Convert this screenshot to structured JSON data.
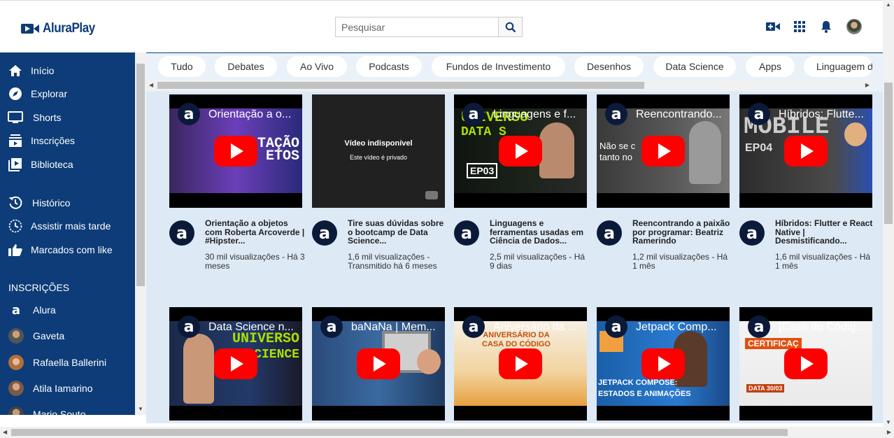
{
  "header": {
    "logo_text": "AluraPlay",
    "search_placeholder": "Pesquisar"
  },
  "sidebar": {
    "nav": [
      {
        "label": "Início",
        "icon": "home-icon"
      },
      {
        "label": "Explorar",
        "icon": "compass-icon"
      },
      {
        "label": "Shorts",
        "icon": "shorts-icon"
      },
      {
        "label": "Inscrições",
        "icon": "subscriptions-icon"
      },
      {
        "label": "Biblioteca",
        "icon": "library-icon"
      }
    ],
    "nav2": [
      {
        "label": "Histórico",
        "icon": "history-icon"
      },
      {
        "label": "Assistir mais tarde",
        "icon": "clock-icon"
      },
      {
        "label": "Marcados com like",
        "icon": "thumbs-up-icon"
      }
    ],
    "subscriptions_heading": "INSCRIÇÕES",
    "subscriptions": [
      {
        "label": "Alura"
      },
      {
        "label": "Gaveta"
      },
      {
        "label": "Rafaella Ballerini"
      },
      {
        "label": "Atila Iamarino"
      },
      {
        "label": "Mario Souto"
      }
    ]
  },
  "chips": [
    "Tudo",
    "Debates",
    "Ao Vivo",
    "Podcasts",
    "Fundos de Investimento",
    "Desenhos",
    "Data Science",
    "Apps",
    "Linguagem de"
  ],
  "videos": [
    {
      "thumb_title": "Orientação a o...",
      "title": "Orientação a objetos com Roberta Arcoverde | #Hipster...",
      "views": "30 mil visualizações - Há 3 meses"
    },
    {
      "unavailable": "Vídeo indisponível",
      "unavailable_sub": "Este vídeo é privado",
      "title": "Tire suas dúvidas sobre o bootcamp de Data Science...",
      "views": "1,6 mil visualizações - Transmitido há 6 meses"
    },
    {
      "thumb_title": "Linguagens e f...",
      "title": "Linguagens e ferramentas usadas em Ciência de Dados...",
      "views": "2,5 mil visualizações - Há 9 dias"
    },
    {
      "thumb_title": "Reencontrando...",
      "title": "Reencontrando a paixão por programar: Beatriz Ramerindo",
      "views": "1,2 mil visualizações - Há 1 mês"
    },
    {
      "thumb_title": "Híbridos: Flutte...",
      "title": "Híbridos: Flutter e React Native | Desmistificando...",
      "views": "1,6 mil visualizações - Há 1 mês"
    },
    {
      "thumb_title": "Data Science n...",
      "title": "",
      "views": ""
    },
    {
      "thumb_title": "baNaNa | Mem...",
      "title": "",
      "views": ""
    },
    {
      "thumb_title": "Aniversário da ...",
      "title": "",
      "views": ""
    },
    {
      "thumb_title": "Jetpack Comp...",
      "title": "",
      "views": ""
    },
    {
      "thumb_title": "[Casa do Códig...",
      "title": "",
      "views": ""
    }
  ],
  "thumb_texts": {
    "v1": "TAÇÃO\nETOS",
    "v3a": "UNIVERSO",
    "v3b": "DATA S",
    "v3c": "EP03",
    "v4": "Não se c\ntanto no",
    "v5a": "MOBILE",
    "v5b": "EP04",
    "v6a": "UNIVERSO",
    "v6b": "SCIENCE",
    "v8": "ANIVERSÁRIO DA\nCASA DO CÓDIGO",
    "v9": "JETPACK COMPOSE:\nESTADOS E ANIMAÇÕES",
    "v10a": "CERTIFICAÇ",
    "v10b": "DATA 30/03"
  },
  "colors": {
    "brand": "#0d3c78",
    "play": "#ff0000",
    "main_bg": "#dde9f5"
  }
}
